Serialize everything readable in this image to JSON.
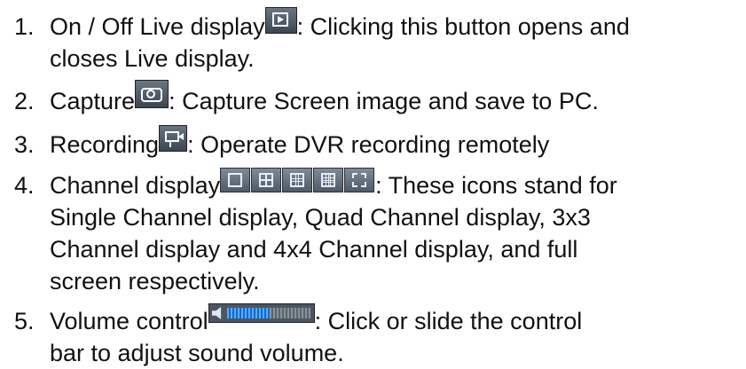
{
  "items": [
    {
      "number": "1.",
      "label": "On / Off Live display",
      "icon": "live-display-icon",
      "description": ": Clicking this button opens and",
      "continuation": [
        "closes Live display."
      ]
    },
    {
      "number": "2.",
      "label": "Capture",
      "icon": "camera-icon",
      "description": ": Capture Screen image and save to PC.",
      "continuation": []
    },
    {
      "number": "3.",
      "label": "Recording",
      "icon": "recording-icon",
      "description": ": Operate DVR recording remotely",
      "continuation": []
    },
    {
      "number": "4.",
      "label": "Channel display",
      "icons": [
        "single-channel-icon",
        "quad-channel-icon",
        "3x3-channel-icon",
        "4x4-channel-icon",
        "full-screen-icon"
      ],
      "description": ": These icons stand for",
      "continuation": [
        "Single Channel display, Quad Channel display, 3x3",
        "Channel display and 4x4 Channel display, and full",
        "screen respectively."
      ]
    },
    {
      "number": "5.",
      "label": "Volume control",
      "icon": "volume-icon",
      "volume_level": 0.5,
      "description": ": Click or slide the control",
      "continuation": [
        "bar to adjust sound volume."
      ]
    }
  ]
}
